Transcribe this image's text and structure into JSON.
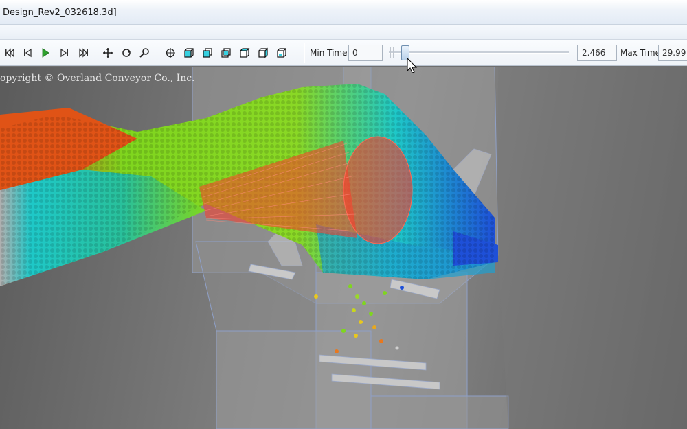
{
  "window": {
    "title": "Design_Rev2_032618.3d]"
  },
  "toolbar": {
    "buttons": [
      {
        "name": "skip-to-start-icon"
      },
      {
        "name": "step-back-icon"
      },
      {
        "name": "play-icon"
      },
      {
        "name": "step-forward-icon"
      },
      {
        "name": "skip-to-end-icon"
      },
      {
        "name": "pan-icon"
      },
      {
        "name": "rotate-icon"
      },
      {
        "name": "zoom-icon"
      },
      {
        "name": "center-view-icon"
      },
      {
        "name": "view-iso-icon"
      },
      {
        "name": "view-front-icon"
      },
      {
        "name": "view-back-icon"
      },
      {
        "name": "view-top-icon"
      },
      {
        "name": "view-side-icon"
      },
      {
        "name": "view-bottom-icon"
      }
    ],
    "min_time_label": "Min Time",
    "min_time_value": "0",
    "current_time_value": "2.466",
    "max_time_label": "Max Time",
    "max_time_value": "29.99",
    "slider_position_fraction": 0.082
  },
  "viewport": {
    "copyright": "opyright © Overland Conveyor Co., Inc."
  },
  "colors": {
    "accent_play": "#2fa12f",
    "particle_hot": "#e8401c",
    "particle_mid": "#7fd61e",
    "particle_cool": "#1ec8c8",
    "particle_cold": "#1e50d8"
  }
}
